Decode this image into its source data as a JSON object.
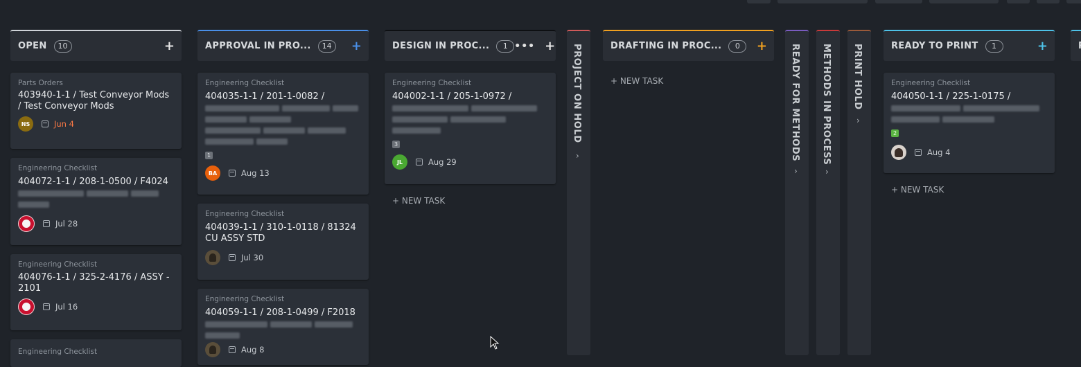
{
  "board": {
    "columns": [
      {
        "title": "OPEN",
        "count": "10",
        "accent": "#cfd3d8",
        "add_label": "+"
      },
      {
        "title": "APPROVAL IN PRO...",
        "count": "14",
        "accent": "#4a8fe7",
        "add_label": "+"
      },
      {
        "title": "DESIGN IN PROC...",
        "count": "1",
        "accent": "#0d0f12",
        "more_label": "•••",
        "add_label": "+",
        "new_task": "+ NEW TASK"
      },
      {
        "title": "DRAFTING IN PROC...",
        "count": "0",
        "accent": "#f0a020",
        "add_label": "+",
        "new_task": "+ NEW TASK"
      },
      {
        "title": "READY TO PRINT",
        "count": "1",
        "accent": "#4ec2e8",
        "add_label": "+",
        "new_task": "+ NEW TASK"
      },
      {
        "title": "P"
      }
    ],
    "collapsed": [
      {
        "title": "PROJECT ON HOLD",
        "accent": "#d05a5a"
      },
      {
        "title": "READY FOR METHODS",
        "accent": "#7a5cc0"
      },
      {
        "title": "METHODS IN PROCESS",
        "accent": "#c93a3a"
      },
      {
        "title": "PRINT HOLD",
        "accent": "#9a5a3a"
      }
    ],
    "cards": {
      "open": [
        {
          "type": "Parts Orders",
          "title": "403940-1-1 / Test Conveyor Mods / Test Conveyor Mods",
          "avatar": "NS",
          "date": "Jun 4"
        },
        {
          "type": "Engineering Checklist",
          "title": "404072-1-1 / 208-1-0500 / F4024",
          "date": "Jul 28"
        },
        {
          "type": "Engineering Checklist",
          "title": "404076-1-1 / 325-2-4176 / ASSY - 2101",
          "date": "Jul 16"
        },
        {
          "type": "Engineering Checklist"
        }
      ],
      "approval": [
        {
          "type": "Engineering Checklist",
          "title": "404035-1-1 / 201-1-0082 /",
          "subtasks": "1",
          "avatar": "BA",
          "date": "Aug 13"
        },
        {
          "type": "Engineering Checklist",
          "title": "404039-1-1 / 310-1-0118 / 81324 CU ASSY STD",
          "date": "Jul 30"
        },
        {
          "type": "Engineering Checklist",
          "title": "404059-1-1 / 208-1-0499 / F2018",
          "date": "Aug 8"
        }
      ],
      "design": [
        {
          "type": "Engineering Checklist",
          "title": "404002-1-1 / 205-1-0972 /",
          "subtasks": "3",
          "avatar": "JL",
          "date": "Aug 29"
        }
      ],
      "ready_print": [
        {
          "type": "Engineering Checklist",
          "title": "404050-1-1 / 225-1-0175 /",
          "subtasks": "2",
          "date": "Aug 4"
        }
      ]
    }
  }
}
